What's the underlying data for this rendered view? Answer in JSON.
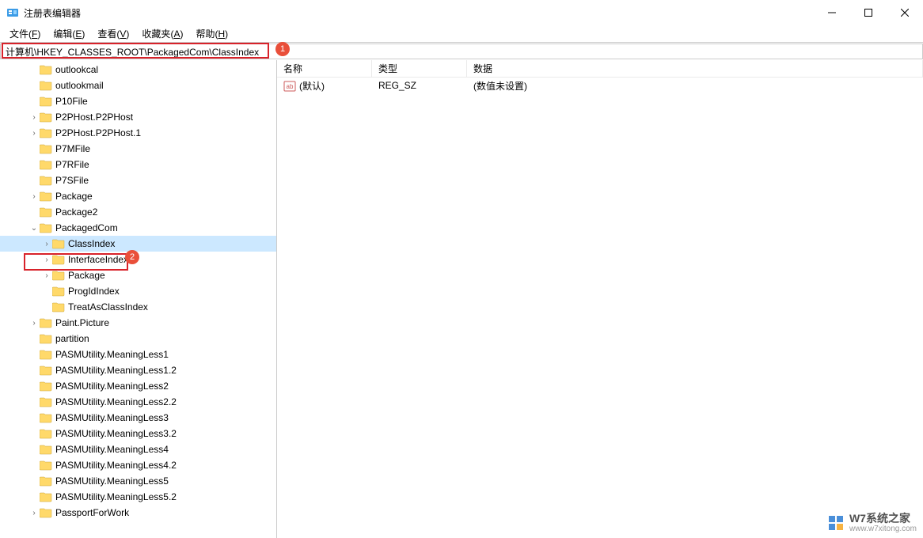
{
  "window": {
    "title": "注册表编辑器"
  },
  "menubar": {
    "file": {
      "label": "文件",
      "accel": "F"
    },
    "edit": {
      "label": "编辑",
      "accel": "E"
    },
    "view": {
      "label": "查看",
      "accel": "V"
    },
    "favorites": {
      "label": "收藏夹",
      "accel": "A"
    },
    "help": {
      "label": "帮助",
      "accel": "H"
    }
  },
  "address": "计算机\\HKEY_CLASSES_ROOT\\PackagedCom\\ClassIndex",
  "annotations": {
    "badge1": "1",
    "badge2": "2"
  },
  "tree": {
    "nodes": [
      {
        "label": "outlookcal",
        "indent": 2,
        "expandable": false
      },
      {
        "label": "outlookmail",
        "indent": 2,
        "expandable": false
      },
      {
        "label": "P10File",
        "indent": 2,
        "expandable": false
      },
      {
        "label": "P2PHost.P2PHost",
        "indent": 2,
        "expandable": true
      },
      {
        "label": "P2PHost.P2PHost.1",
        "indent": 2,
        "expandable": true
      },
      {
        "label": "P7MFile",
        "indent": 2,
        "expandable": false
      },
      {
        "label": "P7RFile",
        "indent": 2,
        "expandable": false
      },
      {
        "label": "P7SFile",
        "indent": 2,
        "expandable": false
      },
      {
        "label": "Package",
        "indent": 2,
        "expandable": true
      },
      {
        "label": "Package2",
        "indent": 2,
        "expandable": false
      },
      {
        "label": "PackagedCom",
        "indent": 2,
        "expandable": true,
        "expanded": true
      },
      {
        "label": "ClassIndex",
        "indent": 3,
        "expandable": true,
        "selected": true
      },
      {
        "label": "InterfaceIndex",
        "indent": 3,
        "expandable": true
      },
      {
        "label": "Package",
        "indent": 3,
        "expandable": true
      },
      {
        "label": "ProgIdIndex",
        "indent": 3,
        "expandable": false
      },
      {
        "label": "TreatAsClassIndex",
        "indent": 3,
        "expandable": false
      },
      {
        "label": "Paint.Picture",
        "indent": 2,
        "expandable": true
      },
      {
        "label": "partition",
        "indent": 2,
        "expandable": false
      },
      {
        "label": "PASMUtility.MeaningLess1",
        "indent": 2,
        "expandable": false
      },
      {
        "label": "PASMUtility.MeaningLess1.2",
        "indent": 2,
        "expandable": false
      },
      {
        "label": "PASMUtility.MeaningLess2",
        "indent": 2,
        "expandable": false
      },
      {
        "label": "PASMUtility.MeaningLess2.2",
        "indent": 2,
        "expandable": false
      },
      {
        "label": "PASMUtility.MeaningLess3",
        "indent": 2,
        "expandable": false
      },
      {
        "label": "PASMUtility.MeaningLess3.2",
        "indent": 2,
        "expandable": false
      },
      {
        "label": "PASMUtility.MeaningLess4",
        "indent": 2,
        "expandable": false
      },
      {
        "label": "PASMUtility.MeaningLess4.2",
        "indent": 2,
        "expandable": false
      },
      {
        "label": "PASMUtility.MeaningLess5",
        "indent": 2,
        "expandable": false
      },
      {
        "label": "PASMUtility.MeaningLess5.2",
        "indent": 2,
        "expandable": false
      },
      {
        "label": "PassportForWork",
        "indent": 2,
        "expandable": true
      }
    ]
  },
  "values": {
    "columns": {
      "name": "名称",
      "type": "类型",
      "data": "数据"
    },
    "rows": [
      {
        "name": "(默认)",
        "type": "REG_SZ",
        "data": "(数值未设置)"
      }
    ]
  },
  "watermark": {
    "big": "W7系统之家",
    "small": "www.w7xitong.com"
  }
}
